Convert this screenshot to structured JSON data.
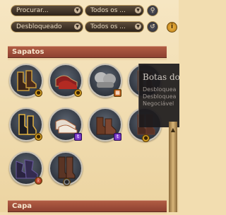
{
  "filters": {
    "search_placeholder": "Procurar...",
    "category_top": "Todos os ...",
    "status": "Desbloqueado",
    "category_bottom": "Todos os ..."
  },
  "sections": {
    "shoes": "Sapatos",
    "cape": "Capa"
  },
  "tooltip": {
    "title": "Botas do",
    "lines": [
      "Desbloquea",
      "Desbloquea",
      "Negociável"
    ]
  },
  "colors": {
    "accent": "#f0b94a",
    "header": "#a35039",
    "panel": "#f2ddb0"
  },
  "items": [
    {
      "name": "dark-boots-gold-trim",
      "badge_icon": "gold-coin-icon"
    },
    {
      "name": "red-pointed-shoes",
      "badge_icon": "gold-coin-icon"
    },
    {
      "name": "grey-fur-boots",
      "badge_icon": "calendar-icon"
    },
    {
      "name": "dark-heeled-boots",
      "badge_icon": ""
    },
    {
      "name": "black-gold-boots",
      "badge_icon": "gold-coin-icon"
    },
    {
      "name": "white-pointed-shoes",
      "badge_icon": "twitch-icon"
    },
    {
      "name": "brown-leather-boots",
      "badge_icon": "twitch-icon"
    },
    {
      "name": "brown-cuffed-boots",
      "badge_icon": "gold-coin-icon"
    },
    {
      "name": "purple-winged-boots",
      "badge_icon": "rune-icon"
    },
    {
      "name": "tall-brown-boots",
      "badge_icon": "grey-coin-icon"
    }
  ]
}
